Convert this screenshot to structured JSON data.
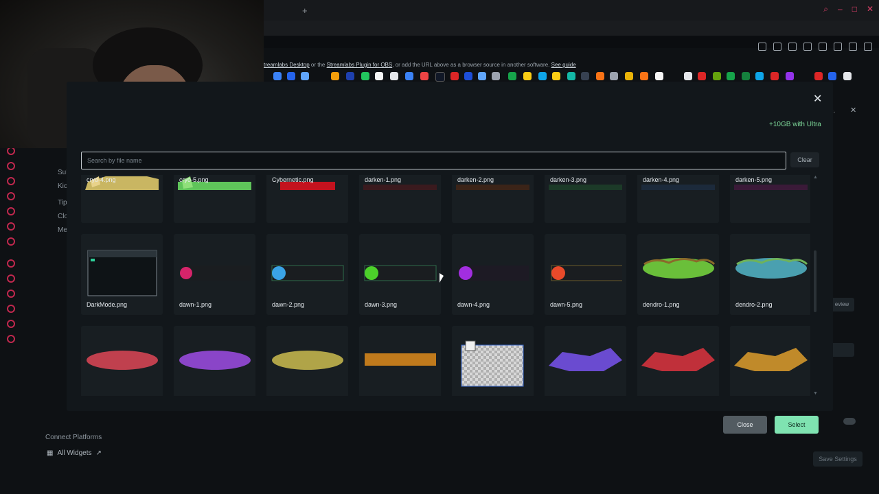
{
  "browser": {
    "new_tab": "+"
  },
  "page": {
    "info_line": {
      "part1": "treamlabs Desktop",
      "part2": " or the ",
      "part3": "Streamlabs Plugin for OBS",
      "part4": ", or add the URL above as a browser source in another software. ",
      "part5": "See guide"
    },
    "side_items": [
      "Sul",
      "Kic",
      "Tip",
      "Clo",
      "Me"
    ],
    "connect_platforms": "Connect Platforms",
    "all_widgets": "All Widgets",
    "save_settings": "Save Settings",
    "review_label": "eview",
    "partial_right": "e."
  },
  "modal": {
    "ultra_link": "+10GB with Ultra",
    "search_placeholder": "Search by file name",
    "clear_label": "Clear",
    "close_label": "Close",
    "select_label": "Select"
  },
  "files_row1": [
    "cryo-4.png",
    "cryo-5.png",
    "Cybernetic.png",
    "darken-1.png",
    "darken-2.png",
    "darken-3.png",
    "darken-4.png",
    "darken-5.png"
  ],
  "files_row2": [
    "DarkMode.png",
    "dawn-1.png",
    "dawn-2.png",
    "dawn-3.png",
    "dawn-4.png",
    "dawn-5.png",
    "dendro-1.png",
    "dendro-2.png"
  ],
  "files_row3_colors": [
    "#c0404e",
    "#8a45c8",
    "#b0a448",
    "#c07a1c",
    "#cccccc",
    "#6a4bd0",
    "#c0303a",
    "#c08a2a"
  ],
  "colors": {
    "accent_green": "#7fe3b1",
    "ultra": "#7ed99a",
    "brand_red": "#e0406a"
  }
}
